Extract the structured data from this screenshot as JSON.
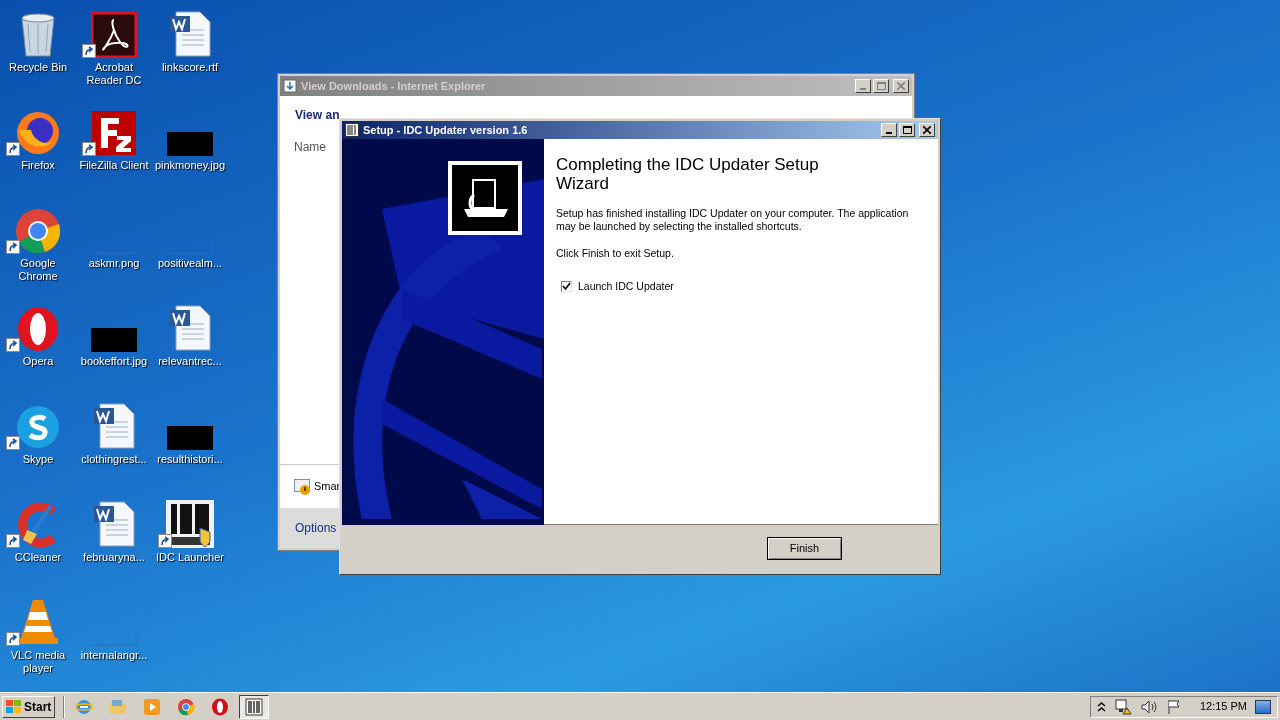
{
  "desktop_icons": [
    {
      "label": "Recycle Bin",
      "kind": "recycle",
      "shortcut": false
    },
    {
      "label": "Firefox",
      "kind": "firefox",
      "shortcut": true
    },
    {
      "label": "Google Chrome",
      "kind": "chrome",
      "shortcut": true
    },
    {
      "label": "Opera",
      "kind": "opera",
      "shortcut": true
    },
    {
      "label": "Skype",
      "kind": "skype",
      "shortcut": true
    },
    {
      "label": "CCleaner",
      "kind": "ccleaner",
      "shortcut": true
    },
    {
      "label": "VLC media player",
      "kind": "vlc",
      "shortcut": true
    },
    {
      "label": "Acrobat Reader DC",
      "kind": "acrobat",
      "shortcut": true
    },
    {
      "label": "FileZilla Client",
      "kind": "filezilla",
      "shortcut": true
    },
    {
      "label": "askmr.png",
      "kind": "blank",
      "shortcut": false
    },
    {
      "label": "bookeffort.jpg",
      "kind": "black",
      "shortcut": false
    },
    {
      "label": "clothingrest...",
      "kind": "word",
      "shortcut": false
    },
    {
      "label": "februaryna...",
      "kind": "word",
      "shortcut": false
    },
    {
      "label": "internalangr...",
      "kind": "blank",
      "shortcut": false
    },
    {
      "label": "linkscore.rtf",
      "kind": "word",
      "shortcut": false
    },
    {
      "label": "pinkmoney.jpg",
      "kind": "black",
      "shortcut": false
    },
    {
      "label": "positivealm...",
      "kind": "blank",
      "shortcut": false
    },
    {
      "label": "relevantrec...",
      "kind": "word",
      "shortcut": false
    },
    {
      "label": "resulthistori...",
      "kind": "black",
      "shortcut": false
    },
    {
      "label": "IDC Launcher",
      "kind": "idc",
      "shortcut": true
    }
  ],
  "ie_window": {
    "title": "View Downloads - Internet Explorer",
    "heading": "View an",
    "column_1": "Name",
    "footer_item": "Smar",
    "options_link": "Options"
  },
  "setup_window": {
    "title": "Setup - IDC Updater version 1.6",
    "heading": "Completing the IDC Updater Setup Wizard",
    "body": "Setup has finished installing IDC Updater on your computer. The application may be launched by selecting the installed shortcuts.",
    "instruction": "Click Finish to exit Setup.",
    "launch_checkbox": {
      "label": "Launch IDC Updater",
      "checked": true
    },
    "finish_button": "Finish"
  },
  "taskbar": {
    "start": "Start",
    "items": [
      {
        "kind": "ie",
        "selected": false
      },
      {
        "kind": "folder",
        "selected": false
      },
      {
        "kind": "media",
        "selected": false
      },
      {
        "kind": "chrome",
        "selected": false
      },
      {
        "kind": "opera",
        "selected": false
      },
      {
        "kind": "idc",
        "selected": true
      }
    ],
    "clock": "12:15 PM"
  }
}
